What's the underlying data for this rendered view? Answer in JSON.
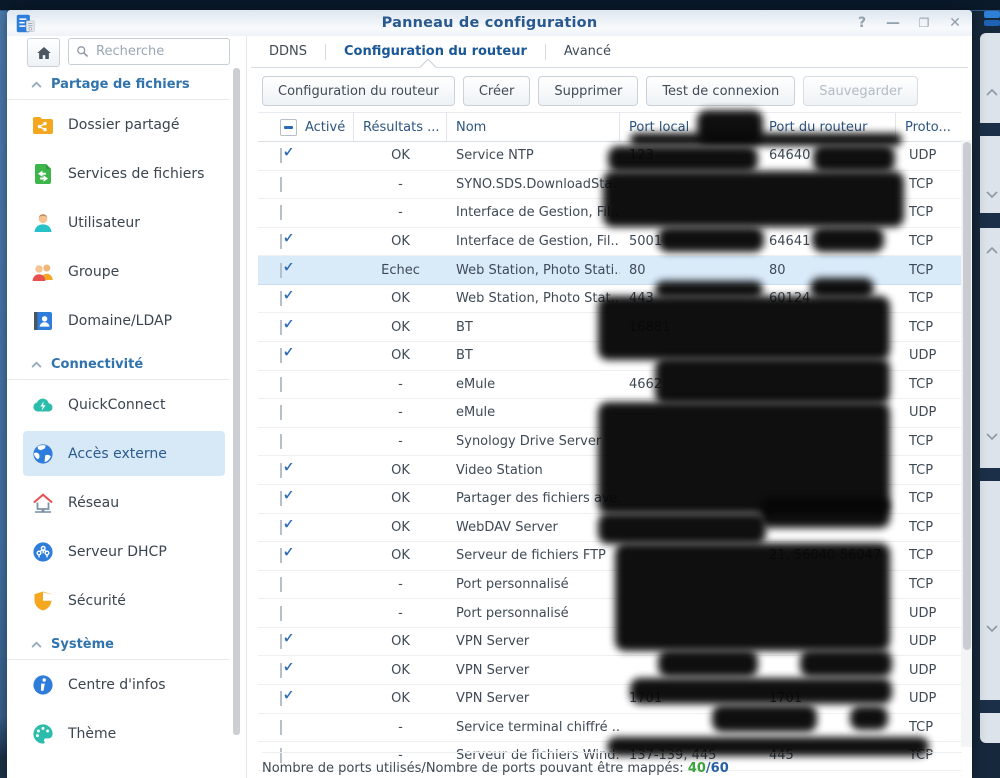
{
  "window": {
    "title": "Panneau de configuration",
    "controls": {
      "help": "?",
      "minimize": "—",
      "maximize": "❐",
      "close": "✕"
    }
  },
  "sidebar": {
    "search_placeholder": "Recherche",
    "sections": [
      {
        "label": "Partage de fichiers"
      },
      {
        "label": "Connectivité"
      },
      {
        "label": "Système"
      }
    ],
    "items": [
      {
        "label": "Dossier partagé",
        "icon": "shared-folder-icon"
      },
      {
        "label": "Services de fichiers",
        "icon": "file-services-icon"
      },
      {
        "label": "Utilisateur",
        "icon": "user-icon"
      },
      {
        "label": "Groupe",
        "icon": "group-icon"
      },
      {
        "label": "Domaine/LDAP",
        "icon": "domain-ldap-icon"
      },
      {
        "label": "QuickConnect",
        "icon": "quickconnect-cloud-icon"
      },
      {
        "label": "Accès externe",
        "icon": "globe-icon"
      },
      {
        "label": "Réseau",
        "icon": "network-house-icon"
      },
      {
        "label": "Serveur DHCP",
        "icon": "dhcp-icon"
      },
      {
        "label": "Sécurité",
        "icon": "shield-icon"
      },
      {
        "label": "Centre d'infos",
        "icon": "info-icon"
      },
      {
        "label": "Thème",
        "icon": "theme-palette-icon"
      }
    ],
    "selected_item": "Accès externe"
  },
  "tabs": [
    {
      "label": "DDNS",
      "active": false
    },
    {
      "label": "Configuration du routeur",
      "active": true
    },
    {
      "label": "Avancé",
      "active": false
    }
  ],
  "toolbar": {
    "buttons": [
      {
        "label": "Configuration du routeur",
        "disabled": false
      },
      {
        "label": "Créer",
        "disabled": false
      },
      {
        "label": "Supprimer",
        "disabled": false
      },
      {
        "label": "Test de connexion",
        "disabled": false
      },
      {
        "label": "Sauvegarder",
        "disabled": true
      }
    ]
  },
  "table": {
    "columns": [
      "Activé",
      "Résultats ...",
      "Nom",
      "Port local",
      "Port du routeur",
      "Proto..."
    ],
    "rows": [
      {
        "enabled": true,
        "result": "OK",
        "name": "Service NTP",
        "port_local": "123",
        "port_router": "64640",
        "protocol": "UDP",
        "highlighted": false
      },
      {
        "enabled": false,
        "result": "-",
        "name": "SYNO.SDS.DownloadSta...",
        "port_local": "",
        "port_router": "",
        "protocol": "TCP",
        "highlighted": false
      },
      {
        "enabled": false,
        "result": "-",
        "name": "Interface de Gestion, Fil...",
        "port_local": "",
        "port_router": "",
        "protocol": "TCP",
        "highlighted": false
      },
      {
        "enabled": true,
        "result": "OK",
        "name": "Interface de Gestion, Fil...",
        "port_local": "5001",
        "port_router": "64641",
        "protocol": "TCP",
        "highlighted": false
      },
      {
        "enabled": true,
        "result": "Échec",
        "name": "Web Station, Photo Stati...",
        "port_local": "80",
        "port_router": "80",
        "protocol": "TCP",
        "highlighted": true
      },
      {
        "enabled": true,
        "result": "OK",
        "name": "Web Station, Photo Stat...",
        "port_local": "443",
        "port_router": "60124",
        "protocol": "TCP",
        "highlighted": false
      },
      {
        "enabled": true,
        "result": "OK",
        "name": "BT",
        "port_local": "16881",
        "port_router": "",
        "protocol": "TCP",
        "highlighted": false
      },
      {
        "enabled": true,
        "result": "OK",
        "name": "BT",
        "port_local": "",
        "port_router": "",
        "protocol": "UDP",
        "highlighted": false
      },
      {
        "enabled": false,
        "result": "-",
        "name": "eMule",
        "port_local": "4662",
        "port_router": "",
        "protocol": "TCP",
        "highlighted": false
      },
      {
        "enabled": false,
        "result": "-",
        "name": "eMule",
        "port_local": "",
        "port_router": "",
        "protocol": "UDP",
        "highlighted": false
      },
      {
        "enabled": false,
        "result": "-",
        "name": "Synology Drive Server",
        "port_local": "",
        "port_router": "",
        "protocol": "TCP",
        "highlighted": false
      },
      {
        "enabled": true,
        "result": "OK",
        "name": "Video Station",
        "port_local": "",
        "port_router": "",
        "protocol": "TCP",
        "highlighted": false
      },
      {
        "enabled": true,
        "result": "OK",
        "name": "Partager des fichiers ave...",
        "port_local": "",
        "port_router": "",
        "protocol": "TCP",
        "highlighted": false
      },
      {
        "enabled": true,
        "result": "OK",
        "name": "WebDAV Server",
        "port_local": "",
        "port_router": "",
        "protocol": "TCP",
        "highlighted": false
      },
      {
        "enabled": true,
        "result": "OK",
        "name": "Serveur de fichiers FTP",
        "port_local": "",
        "port_router": "21, 56040-56047",
        "protocol": "TCP",
        "highlighted": false
      },
      {
        "enabled": false,
        "result": "-",
        "name": "Port personnalisé",
        "port_local": "",
        "port_router": "",
        "protocol": "TCP",
        "highlighted": false
      },
      {
        "enabled": false,
        "result": "-",
        "name": "Port personnalisé",
        "port_local": "",
        "port_router": "",
        "protocol": "UDP",
        "highlighted": false
      },
      {
        "enabled": true,
        "result": "OK",
        "name": "VPN Server",
        "port_local": "",
        "port_router": "",
        "protocol": "UDP",
        "highlighted": false
      },
      {
        "enabled": true,
        "result": "OK",
        "name": "VPN Server",
        "port_local": "",
        "port_router": "",
        "protocol": "UDP",
        "highlighted": false
      },
      {
        "enabled": true,
        "result": "OK",
        "name": "VPN Server",
        "port_local": "1701",
        "port_router": "1701",
        "protocol": "UDP",
        "highlighted": false
      },
      {
        "enabled": false,
        "result": "-",
        "name": "Service terminal chiffré ...",
        "port_local": "",
        "port_router": "",
        "protocol": "TCP",
        "highlighted": false
      },
      {
        "enabled": false,
        "result": "-",
        "name": "Serveur de fichiers Wind...",
        "port_local": "137-139, 445",
        "port_router": "445",
        "protocol": "TCP",
        "highlighted": false
      }
    ]
  },
  "footer": {
    "label": "Nombre de ports utilisés/Nombre de ports pouvant être mappés: ",
    "used": "40",
    "total": "/60"
  },
  "colors": {
    "accent": "#1a5796",
    "selected_row": "#d9eaf9",
    "used_green": "#3da23d",
    "desktop": "#16293c"
  }
}
